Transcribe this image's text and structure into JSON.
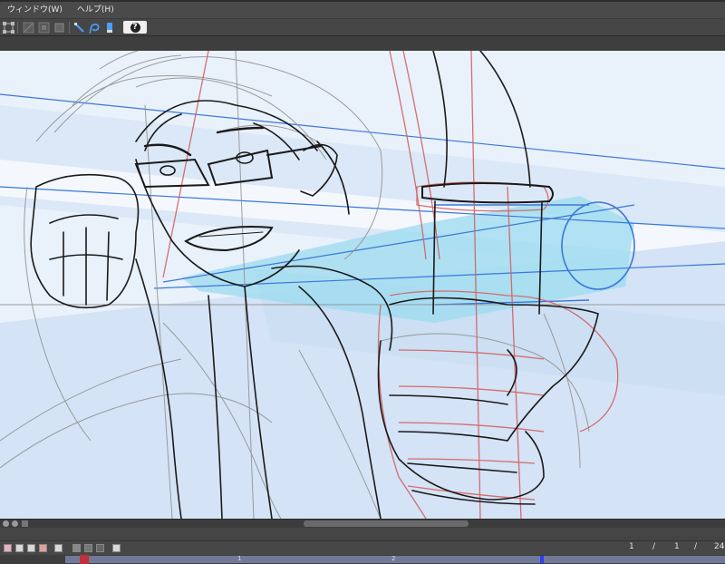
{
  "menu": {
    "window": "ウィンドウ(W)",
    "help": "ヘルプ(H)"
  },
  "toolbar": {
    "icons": [
      "transform-icon",
      "layer-icon",
      "mask-icon",
      "square-icon",
      "pen-icon",
      "lasso-icon",
      "bucket-icon",
      "help-icon"
    ]
  },
  "timeline": {
    "current_frame": "1",
    "page": "1",
    "separator": "/",
    "total_frames": "24"
  },
  "ruler": {
    "mark_1": "1",
    "mark_2": "2"
  },
  "colors": {
    "canvas_bg": "#e9f1fb",
    "sketch_black": "#1a1a1a",
    "sketch_red": "#d46060",
    "sketch_blue": "#3a78d8",
    "highlight_cyan": "#9fdcf0"
  }
}
